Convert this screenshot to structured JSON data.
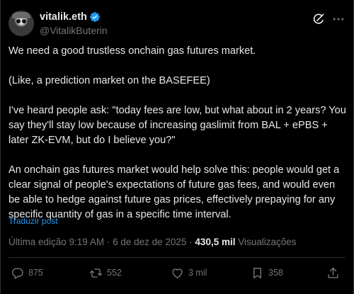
{
  "author": {
    "display_name": "vitalik.eth",
    "handle": "@VitalikButerin",
    "verified": true
  },
  "tweet": {
    "text": "We need a good trustless onchain gas futures market.\n\n(Like, a prediction market on the BASEFEE)\n\nI've heard people ask: \"today fees are low, but what about in 2 years? You say they'll stay low because of increasing gaslimit from BAL + ePBS + later ZK-EVM, but do I believe you?\"\n\nAn onchain gas futures market would help solve this: people would get a clear signal of people's expectations of future gas fees, and would even be able to hedge against future gas prices, effectively prepaying for any specific quantity of gas in a specific time interval.",
    "translate_label": "Traduzir post"
  },
  "meta": {
    "edited": "Última edição 9:19 AM",
    "separator1": " · ",
    "date": "6 de dez de 2025",
    "separator2": " · ",
    "views_count": "430,5 mil",
    "views_label": " Visualizações"
  },
  "actions": {
    "replies": "875",
    "reposts": "552",
    "likes": "3 mil",
    "bookmarks": "358"
  },
  "colors": {
    "accent": "#1d9bf0",
    "background": "#000000",
    "text": "#e7e9ea",
    "muted": "#71767b"
  },
  "icons": [
    "verified-badge-icon",
    "grok-icon",
    "more-icon",
    "reply-icon",
    "repost-icon",
    "like-icon",
    "bookmark-icon",
    "share-icon"
  ]
}
